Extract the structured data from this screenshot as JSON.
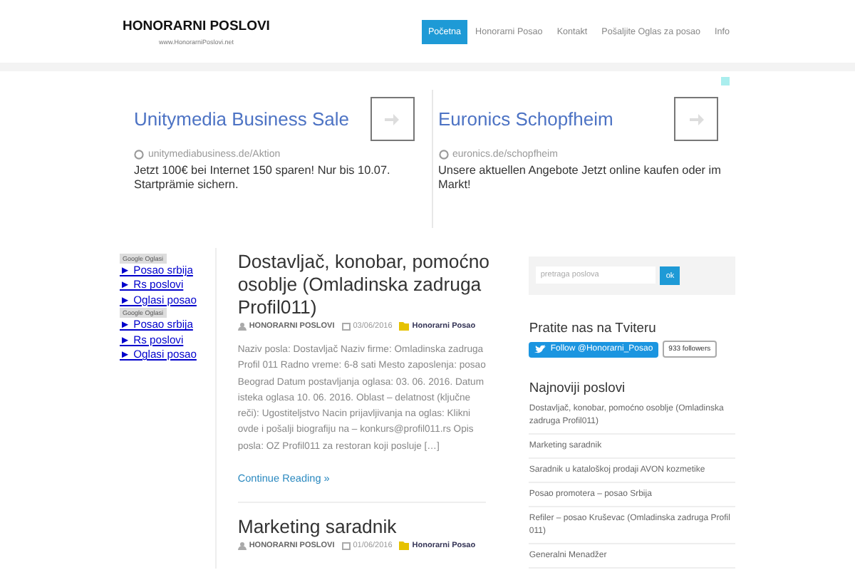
{
  "header": {
    "logo": "HONORARNI POSLOVI",
    "tagline": "www.HonorarniPoslovi.net",
    "nav": [
      {
        "label": "Početna",
        "selected": true
      },
      {
        "label": "Honorarni Posao",
        "selected": false
      },
      {
        "label": "Kontakt",
        "selected": false
      },
      {
        "label": "Pošaljite Oglas za posao",
        "selected": false
      },
      {
        "label": "Info",
        "selected": false
      }
    ]
  },
  "ads": [
    {
      "title": "Unitymedia Business Sale",
      "url": "unitymediabusiness.de/Aktion",
      "text": "Jetzt 100€ bei Internet 150 sparen! Nur bis 10.07. Startprämie sichern."
    },
    {
      "title": "Euronics Schopfheim",
      "url": "euronics.de/schopfheim",
      "text": "Unsere aktuellen Angebote Jetzt online kaufen oder im Markt!"
    }
  ],
  "left_sidebar": [
    {
      "label": "Google Oglasi",
      "links": [
        "► Posao srbija",
        "► Rs poslovi",
        "► Oglasi posao"
      ]
    },
    {
      "label": "Google Oglasi",
      "links": [
        "► Posao srbija",
        "► Rs poslovi",
        "► Oglasi posao"
      ]
    }
  ],
  "posts": [
    {
      "title": "Dostavljač, konobar, pomoćno osoblje (Omladinska zadruga Profil011)",
      "author": "HONORARNI POSLOVI",
      "date": "03/06/2016",
      "category": "Honorarni Posao",
      "excerpt": "Naziv posla: Dostavljač Naziv firme: Omladinska zadruga Profil 011 Radno vreme: 6-8 sati Mesto zaposlenja: posao Beograd Datum postavljanja oglasa: 03. 06. 2016. Datum isteka oglasa 10. 06. 2016. Oblast – delatnost (ključne reči): Ugostiteljstvo Nacin prijavljivanja na oglas: Klikni ovde i pošalji biografiju na – konkurs@profil011.rs Opis posla: OZ Profil011 za restoran koji posluje […]",
      "more": "Continue Reading »"
    },
    {
      "title": "Marketing saradnik",
      "author": "HONORARNI POSLOVI",
      "date": "01/06/2016",
      "category": "Honorarni Posao"
    }
  ],
  "right_sidebar": {
    "search": {
      "placeholder": "pretraga poslova",
      "button": "ok"
    },
    "twitter": {
      "heading": "Pratite nas na Tviteru",
      "button": "Follow @Honorarni_Posao",
      "count": "933 followers"
    },
    "recent": {
      "heading": "Najnoviji poslovi",
      "items": [
        "Dostavljač, konobar, pomoćno osoblje (Omladinska zadruga Profil011)",
        "Marketing saradnik",
        "Saradnik u kataloškoj prodaji AVON kozmetike",
        "Posao promotera – posao Srbija",
        "Refiler – posao Kruševac (Omladinska zadruga Profil 011)",
        "Generalni Menadžer"
      ]
    }
  }
}
